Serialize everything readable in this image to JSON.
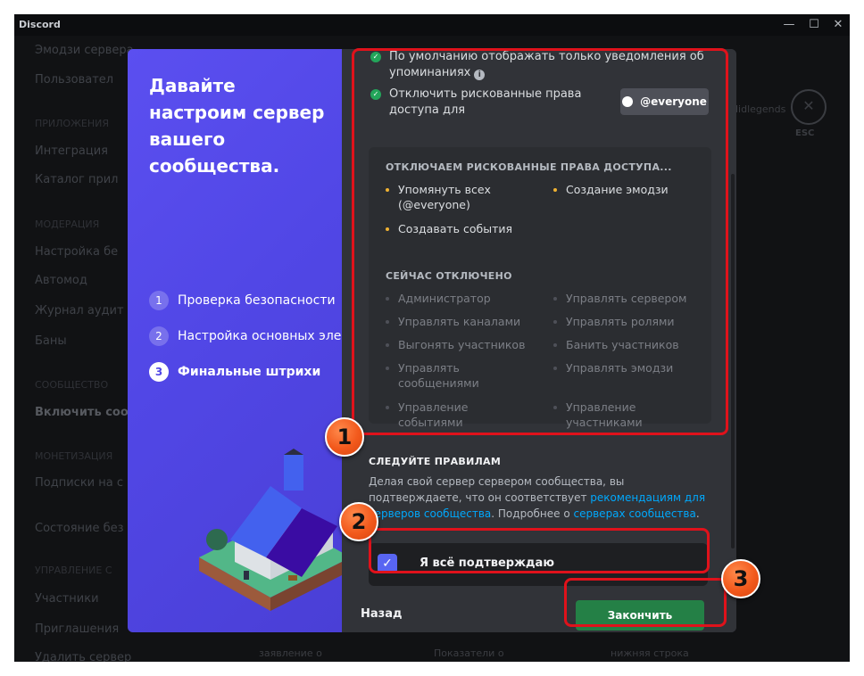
{
  "window": {
    "app_title": "Discord",
    "minimize": "—",
    "maximize": "☐",
    "close": "✕"
  },
  "background": {
    "sidebar_items": [
      "Эмодзи сервера",
      "Пользовател",
      "ПРИЛОЖЕНИЯ",
      "Интеграция",
      "Каталог прил",
      "МОДЕРАЦИЯ",
      "Настройка бе",
      "Автомод",
      "Журнал аудит",
      "Баны",
      "СООБЩЕСТВО",
      "Включить сооб",
      "МОНЕТИЗАЦИЯ",
      "Подписки на с",
      "Состояние без",
      "УПРАВЛЕНИЕ С",
      "Участники",
      "Приглашения",
      "Удалить сервер"
    ],
    "esc_label": "ESC",
    "ghost_username": "lidlegends",
    "ghost_bottom": [
      "заявление о",
      "Показатели о",
      "нижняя строка"
    ]
  },
  "left_panel": {
    "title": "Давайте настроим сервер вашего сообщества.",
    "steps": [
      {
        "num": "1",
        "label": "Проверка безопасности"
      },
      {
        "num": "2",
        "label": "Настройка основных элементов"
      },
      {
        "num": "3",
        "label": "Финальные штрихи"
      }
    ]
  },
  "right_panel": {
    "check_items": [
      {
        "label": "По умолчанию отображать только уведомления об упоминаниях",
        "icon": "info-icon"
      },
      {
        "label": "Отключить рискованные права доступа для"
      }
    ],
    "everyone_button": "@everyone",
    "risky_header": "ОТКЛЮЧАЕМ РИСКОВАННЫЕ ПРАВА ДОСТУПА...",
    "risky_perms": [
      "Упомянуть всех (@everyone)",
      "Создание эмодзи",
      "Создавать события"
    ],
    "disabled_header": "СЕЙЧАС ОТКЛЮЧЕНО",
    "disabled_perms": [
      "Администратор",
      "Управлять сервером",
      "Управлять каналами",
      "Управлять ролями",
      "Выгонять участников",
      "Банить участников",
      "Управлять сообщениями",
      "Управлять эмодзи",
      "Управление событиями",
      "Управление участниками"
    ],
    "rules_header": "СЛЕДУЙТЕ ПРАВИЛАМ",
    "rules_text_1": "Делая свой сервер сервером сообщества, вы подтверждаете, что он соответствует ",
    "rules_link_1": "рекомендациям для серверов сообщества",
    "rules_text_2": ". Подробнее о ",
    "rules_link_2": "серверах сообщества",
    "rules_text_3": ".",
    "confirm_label": "Я всё подтверждаю",
    "confirm_checked": true,
    "back_label": "Назад",
    "finish_label": "Закончить настройку"
  },
  "annotations": [
    "1",
    "2",
    "3"
  ],
  "colors": {
    "accent": "#5865f2",
    "success": "#248046",
    "highlight": "#e0121b",
    "marker": "#f2591c"
  }
}
